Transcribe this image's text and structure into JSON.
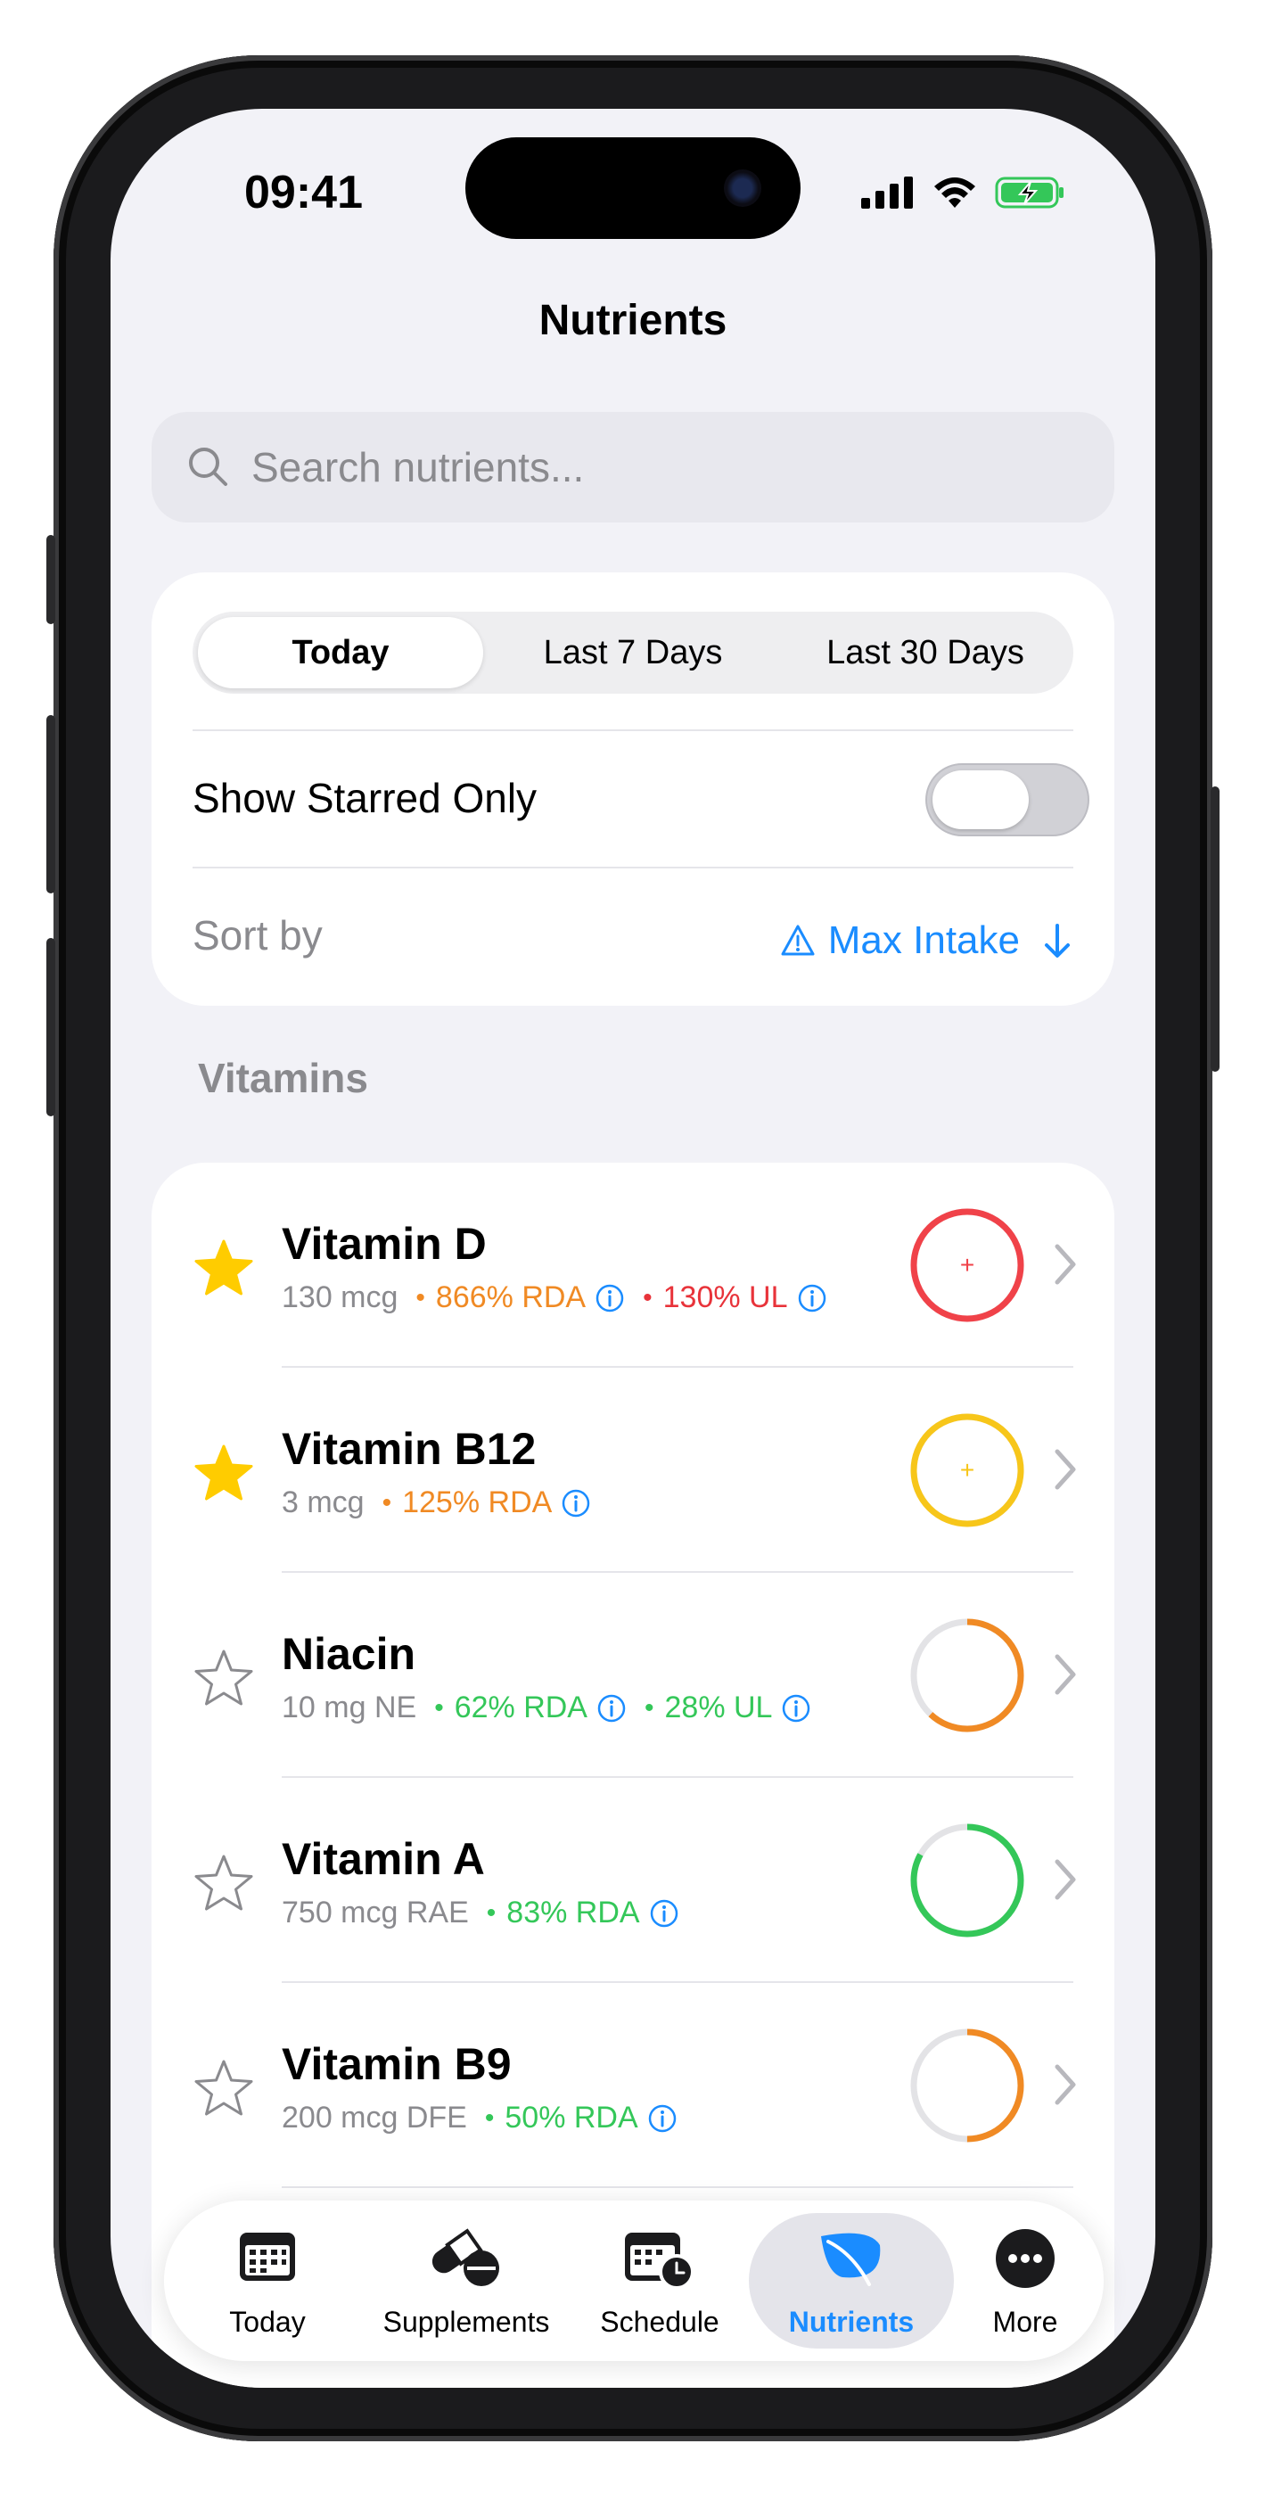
{
  "status_bar": {
    "time": "09:41"
  },
  "header": {
    "title": "Nutrients"
  },
  "search": {
    "placeholder": "Search nutrients..."
  },
  "filters": {
    "segments": [
      "Today",
      "Last 7 Days",
      "Last 30 Days"
    ],
    "selected_segment": "Today",
    "starred_label": "Show Starred Only",
    "starred_on": false,
    "sort_label": "Sort by",
    "sort_value": "Max Intake"
  },
  "section": {
    "title": "Vitamins"
  },
  "nutrients": [
    {
      "name": "Vitamin D",
      "amount": "130 mcg",
      "starred": true,
      "stats": [
        {
          "text": "866% RDA",
          "color": "#f08a24"
        },
        {
          "text": "130% UL",
          "color": "#e8333a"
        }
      ],
      "ring_color": "#f04249",
      "ring_fraction": 1.0,
      "ring_symbol": "+"
    },
    {
      "name": "Vitamin B12",
      "amount": "3 mcg",
      "starred": true,
      "stats": [
        {
          "text": "125% RDA",
          "color": "#f08a24"
        }
      ],
      "ring_color": "#f7c61a",
      "ring_fraction": 1.0,
      "ring_symbol": "+"
    },
    {
      "name": "Niacin",
      "amount": "10 mg NE",
      "starred": false,
      "stats": [
        {
          "text": "62% RDA",
          "color": "#34c759"
        },
        {
          "text": "28% UL",
          "color": "#34c759"
        }
      ],
      "ring_color": "#f08a24",
      "ring_fraction": 0.62,
      "ring_symbol": ""
    },
    {
      "name": "Vitamin A",
      "amount": "750 mcg RAE",
      "starred": false,
      "stats": [
        {
          "text": "83% RDA",
          "color": "#34c759"
        }
      ],
      "ring_color": "#34c759",
      "ring_fraction": 0.83,
      "ring_symbol": ""
    },
    {
      "name": "Vitamin B9",
      "amount": "200 mcg DFE",
      "starred": false,
      "stats": [
        {
          "text": "50% RDA",
          "color": "#34c759"
        }
      ],
      "ring_color": "#f08a24",
      "ring_fraction": 0.5,
      "ring_symbol": ""
    }
  ],
  "tabbar": {
    "tabs": [
      {
        "label": "Today",
        "icon": "calendar-icon"
      },
      {
        "label": "Supplements",
        "icon": "pills-icon"
      },
      {
        "label": "Schedule",
        "icon": "calendar-clock-icon"
      },
      {
        "label": "Nutrients",
        "icon": "leaf-icon"
      },
      {
        "label": "More",
        "icon": "more-icon"
      }
    ],
    "active": "Nutrients",
    "accent": "#1a8cff"
  }
}
